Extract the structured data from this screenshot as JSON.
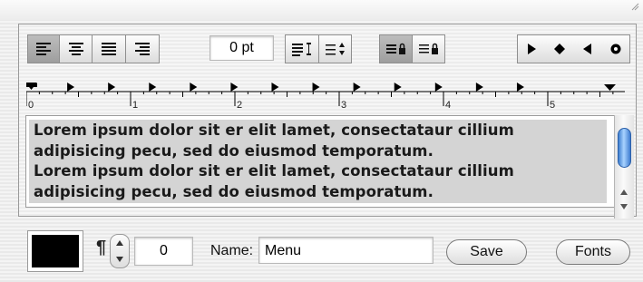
{
  "toolbar": {
    "spacing_value": "0 pt",
    "alignment_buttons": [
      "align-left",
      "align-center",
      "align-justify",
      "align-right"
    ],
    "active_alignment": "align-left"
  },
  "ruler": {
    "labels": [
      "0",
      "1",
      "2",
      "3",
      "4",
      "5"
    ]
  },
  "text_content": {
    "lines": [
      "Lorem ipsum dolor sit er elit lamet, consectataur cillium",
      "adipisicing pecu, sed do eiusmod temporatum.",
      "Lorem ipsum dolor sit er elit lamet, consectataur cillium",
      "adipisicing pecu, sed do eiusmod temporatum."
    ]
  },
  "bottom_bar": {
    "color_swatch": "#000000",
    "paragraph_count": "0",
    "name_label": "Name:",
    "name_value": "Menu",
    "save_label": "Save",
    "fonts_label": "Fonts"
  },
  "colors": {
    "selection": "#d4d4d4",
    "scroll_thumb": "#5a9be6",
    "pressed_button": "#a9a9a9"
  }
}
